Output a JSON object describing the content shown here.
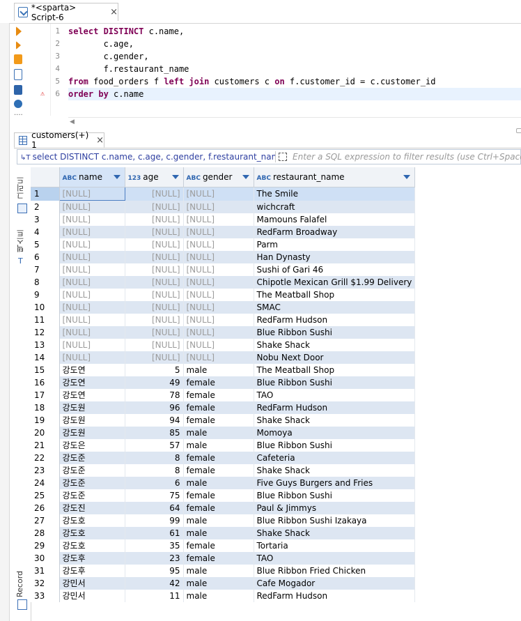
{
  "editor_tab": {
    "title": "*<sparta> Script-6",
    "close": "×"
  },
  "sql_lines": [
    {
      "n": "1",
      "segments": [
        {
          "t": "select DISTINCT",
          "kw": true
        },
        {
          "t": " c.name,",
          "kw": false
        }
      ]
    },
    {
      "n": "2",
      "segments": [
        {
          "t": "       c.age,",
          "kw": false
        }
      ]
    },
    {
      "n": "3",
      "segments": [
        {
          "t": "       c.gender,",
          "kw": false
        }
      ]
    },
    {
      "n": "4",
      "segments": [
        {
          "t": "       f.restaurant_name",
          "kw": false
        }
      ]
    },
    {
      "n": "5",
      "segments": [
        {
          "t": "from",
          "kw": true
        },
        {
          "t": " food_orders f ",
          "kw": false
        },
        {
          "t": "left join",
          "kw": true
        },
        {
          "t": " customers c ",
          "kw": false
        },
        {
          "t": "on",
          "kw": true
        },
        {
          "t": " f.customer_id = c.customer_id",
          "kw": false
        }
      ]
    },
    {
      "n": "6",
      "segments": [
        {
          "t": "order by",
          "kw": true
        },
        {
          "t": " c.name",
          "kw": false
        }
      ]
    }
  ],
  "results_tab": {
    "title": "customers(+) 1",
    "close": "×"
  },
  "filter": {
    "sql": "select DISTINCT c.name, c.age, c.gender, f.restaurant_name from",
    "placeholder": "Enter a SQL expression to filter results (use Ctrl+Space)"
  },
  "side_panel": {
    "grid_label": "그리드",
    "text_label": "텍스트",
    "record_label": "Record"
  },
  "columns": [
    {
      "type": "ABC",
      "name": "name"
    },
    {
      "type": "123",
      "name": "age"
    },
    {
      "type": "ABC",
      "name": "gender"
    },
    {
      "type": "ABC",
      "name": "restaurant_name"
    }
  ],
  "rows": [
    [
      "1",
      "[NULL]",
      "[NULL]",
      "[NULL]",
      "The Smile"
    ],
    [
      "2",
      "[NULL]",
      "[NULL]",
      "[NULL]",
      "wichcraft"
    ],
    [
      "3",
      "[NULL]",
      "[NULL]",
      "[NULL]",
      "Mamouns Falafel"
    ],
    [
      "4",
      "[NULL]",
      "[NULL]",
      "[NULL]",
      "RedFarm Broadway"
    ],
    [
      "5",
      "[NULL]",
      "[NULL]",
      "[NULL]",
      "Parm"
    ],
    [
      "6",
      "[NULL]",
      "[NULL]",
      "[NULL]",
      "Han Dynasty"
    ],
    [
      "7",
      "[NULL]",
      "[NULL]",
      "[NULL]",
      "Sushi of Gari 46"
    ],
    [
      "8",
      "[NULL]",
      "[NULL]",
      "[NULL]",
      "Chipotle Mexican Grill $1.99 Delivery"
    ],
    [
      "9",
      "[NULL]",
      "[NULL]",
      "[NULL]",
      "The Meatball Shop"
    ],
    [
      "10",
      "[NULL]",
      "[NULL]",
      "[NULL]",
      "SMAC"
    ],
    [
      "11",
      "[NULL]",
      "[NULL]",
      "[NULL]",
      "RedFarm Hudson"
    ],
    [
      "12",
      "[NULL]",
      "[NULL]",
      "[NULL]",
      "Blue Ribbon Sushi"
    ],
    [
      "13",
      "[NULL]",
      "[NULL]",
      "[NULL]",
      "Shake Shack"
    ],
    [
      "14",
      "[NULL]",
      "[NULL]",
      "[NULL]",
      "Nobu Next Door"
    ],
    [
      "15",
      "강도연",
      "5",
      "male",
      "The Meatball Shop"
    ],
    [
      "16",
      "강도연",
      "49",
      "female",
      "Blue Ribbon Sushi"
    ],
    [
      "17",
      "강도연",
      "78",
      "female",
      "TAO"
    ],
    [
      "18",
      "강도원",
      "96",
      "female",
      "RedFarm Hudson"
    ],
    [
      "19",
      "강도원",
      "94",
      "female",
      "Shake Shack"
    ],
    [
      "20",
      "강도원",
      "85",
      "male",
      "Momoya"
    ],
    [
      "21",
      "강도은",
      "57",
      "male",
      "Blue Ribbon Sushi"
    ],
    [
      "22",
      "강도준",
      "8",
      "female",
      "Cafeteria"
    ],
    [
      "23",
      "강도준",
      "8",
      "female",
      "Shake Shack"
    ],
    [
      "24",
      "강도준",
      "6",
      "male",
      "Five Guys Burgers and Fries"
    ],
    [
      "25",
      "강도준",
      "75",
      "female",
      "Blue Ribbon Sushi"
    ],
    [
      "26",
      "강도진",
      "64",
      "female",
      "Paul & Jimmys"
    ],
    [
      "27",
      "강도호",
      "99",
      "male",
      "Blue Ribbon Sushi Izakaya"
    ],
    [
      "28",
      "강도호",
      "61",
      "male",
      "Shake Shack"
    ],
    [
      "29",
      "강도호",
      "35",
      "female",
      "Tortaria"
    ],
    [
      "30",
      "강도후",
      "23",
      "female",
      "TAO"
    ],
    [
      "31",
      "강도후",
      "95",
      "male",
      "Blue Ribbon Fried Chicken"
    ],
    [
      "32",
      "강민서",
      "42",
      "male",
      "Cafe Mogador"
    ],
    [
      "33",
      "강민서",
      "11",
      "male",
      "RedFarm Hudson"
    ]
  ],
  "colors": {
    "keyword": "#7f0055",
    "null_text": "#9c9c9c",
    "row_stripe": "#dde6f2",
    "selected_row": "#cfe0f5",
    "filter_sql": "#2d3ea0"
  }
}
